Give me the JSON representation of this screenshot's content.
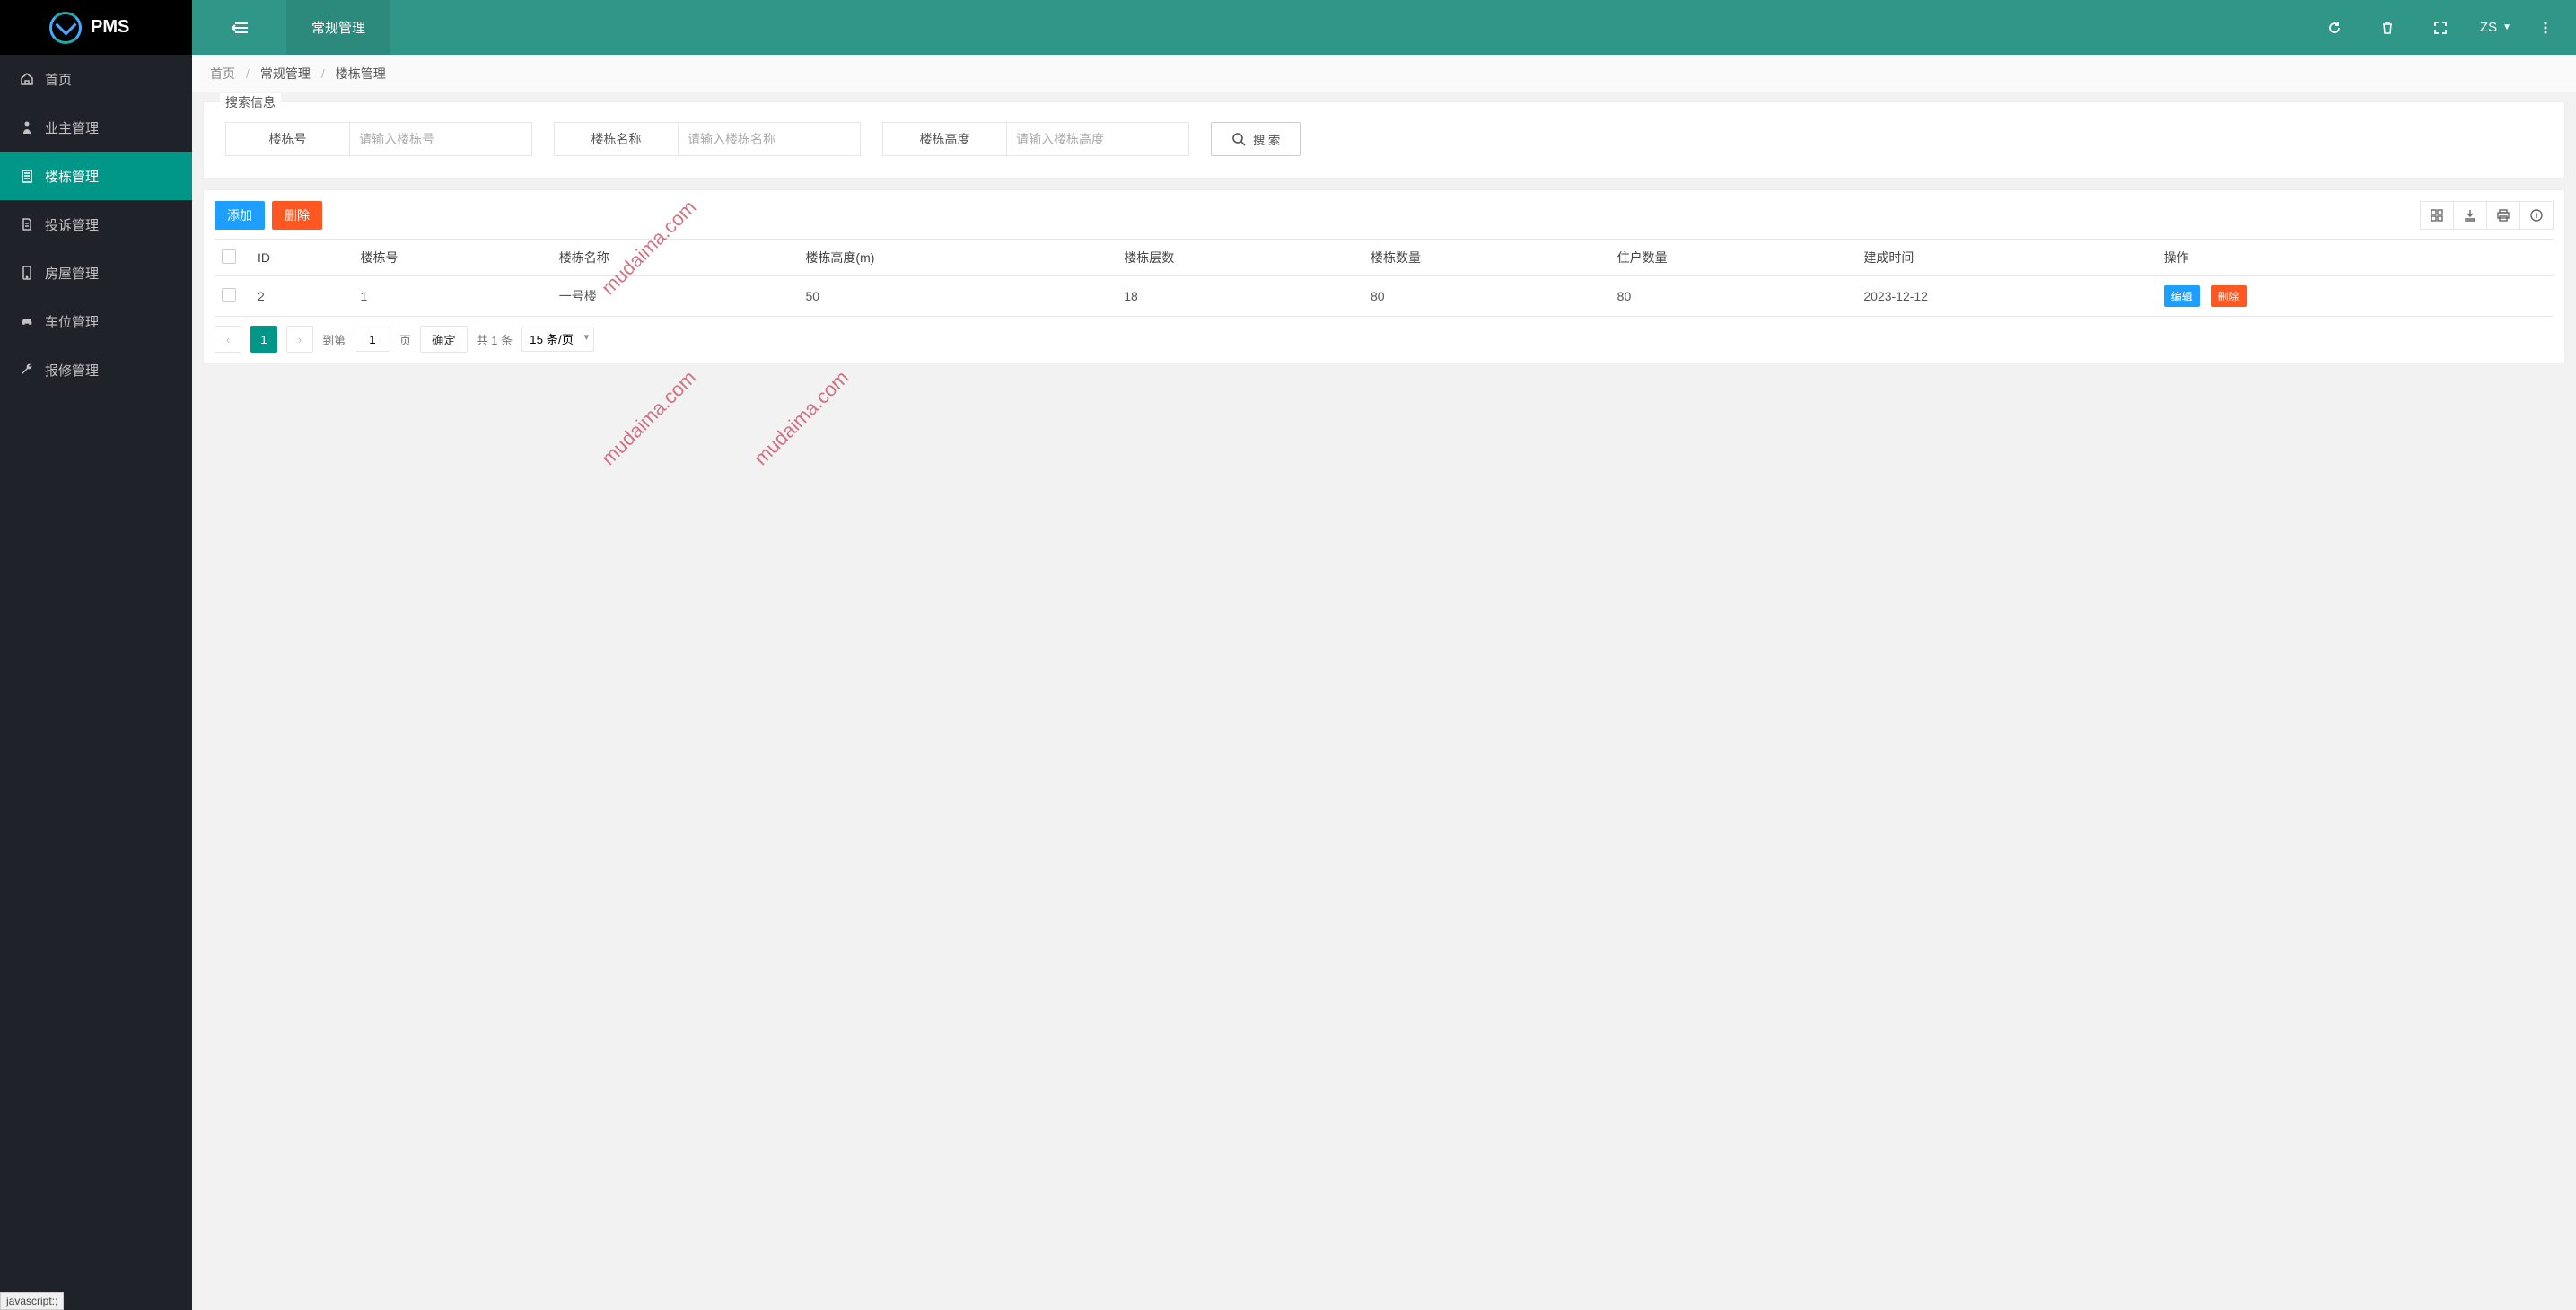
{
  "app": {
    "name": "PMS"
  },
  "topbar": {
    "tab": "常规管理",
    "user": "ZS"
  },
  "sidebar": {
    "items": [
      {
        "icon": "home",
        "label": "首页"
      },
      {
        "icon": "user",
        "label": "业主管理"
      },
      {
        "icon": "building",
        "label": "楼栋管理",
        "active": true
      },
      {
        "icon": "file",
        "label": "投诉管理"
      },
      {
        "icon": "phone",
        "label": "房屋管理"
      },
      {
        "icon": "car",
        "label": "车位管理"
      },
      {
        "icon": "wrench",
        "label": "报修管理"
      }
    ]
  },
  "breadcrumb": {
    "a": "首页",
    "b": "常规管理",
    "c": "楼栋管理"
  },
  "search": {
    "legend": "搜索信息",
    "fields": [
      {
        "label": "楼栋号",
        "placeholder": "请输入楼栋号"
      },
      {
        "label": "楼栋名称",
        "placeholder": "请输入楼栋名称"
      },
      {
        "label": "楼栋高度",
        "placeholder": "请输入楼栋高度"
      }
    ],
    "button": "搜 索"
  },
  "toolbar": {
    "add": "添加",
    "delete": "删除"
  },
  "table": {
    "headers": [
      "",
      "ID",
      "楼栋号",
      "楼栋名称",
      "楼栋高度(m)",
      "楼栋层数",
      "楼栋数量",
      "住户数量",
      "建成时间",
      "操作"
    ],
    "rows": [
      {
        "id": "2",
        "num": "1",
        "name": "一号楼",
        "height": "50",
        "floors": "18",
        "bldg_count": "80",
        "households": "80",
        "built": "2023-12-12"
      }
    ],
    "row_actions": {
      "edit": "编辑",
      "delete": "删除"
    }
  },
  "pager": {
    "current": "1",
    "goto_label": "到第",
    "page_input": "1",
    "page_label": "页",
    "confirm": "确定",
    "total": "共 1 条",
    "perpage": "15 条/页"
  },
  "watermark": "mudaima.com",
  "status": "javascript:;"
}
